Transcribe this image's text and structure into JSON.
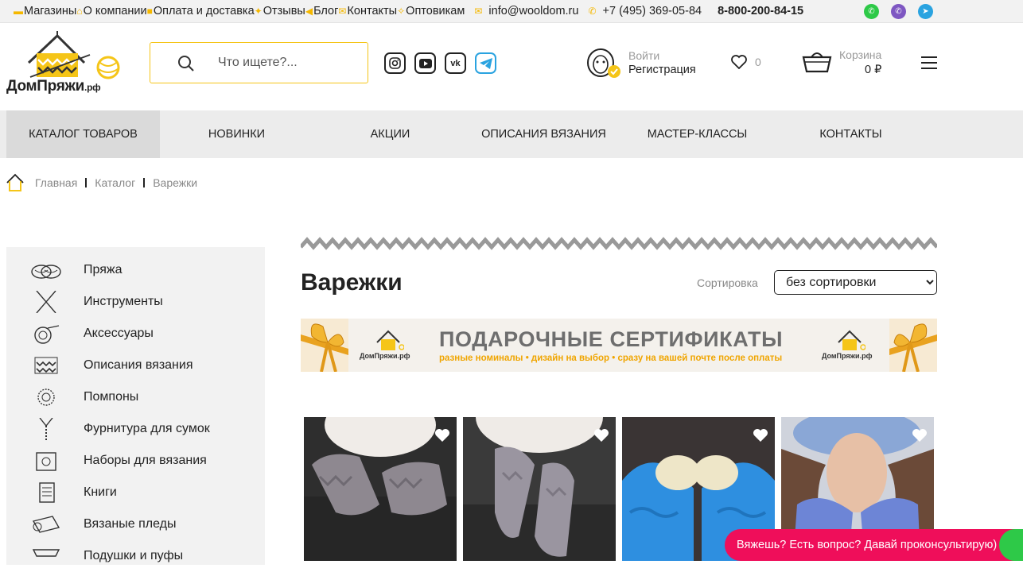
{
  "topbar": {
    "links": [
      "Магазины",
      "О компании",
      "Оплата и доставка",
      "Отзывы",
      "Блог",
      "Контакты",
      "Оптовикам"
    ],
    "email": "info@wooldom.ru",
    "phone": "+7 (495) 369-05-84",
    "free_phone": "8-800-200-84-15",
    "messengers": [
      "whatsapp-icon",
      "viber-icon",
      "telegram-icon"
    ]
  },
  "header": {
    "logo_text": "ДомПряжи",
    "logo_suffix": ".рф",
    "search_placeholder": "Что ищете?...",
    "social": [
      "instagram-icon",
      "youtube-icon",
      "vk-icon",
      "telegram-icon"
    ],
    "login": "Войти",
    "register": "Регистрация",
    "favorites_count": "0",
    "cart_label": "Корзина",
    "cart_total": "0 ₽"
  },
  "nav": [
    "КАТАЛОГ ТОВАРОВ",
    "НОВИНКИ",
    "АКЦИИ",
    "ОПИСАНИЯ ВЯЗАНИЯ",
    "МАСТЕР-КЛАССЫ",
    "КОНТАКТЫ"
  ],
  "breadcrumbs": [
    "Главная",
    "Каталог",
    "Варежки"
  ],
  "sidebar": [
    "Пряжа",
    "Инструменты",
    "Аксессуары",
    "Описания вязания",
    "Помпоны",
    "Фурнитура для сумок",
    "Наборы для вязания",
    "Книги",
    "Вязаные пледы",
    "Подушки и пуфы"
  ],
  "page": {
    "title": "Варежки",
    "sort_label": "Сортировка",
    "sort_value": "без сортировки"
  },
  "banner": {
    "title": "ПОДАРОЧНЫЕ СЕРТИФИКАТЫ",
    "subtitle": "разные номиналы • дизайн на выбор • сразу на вашей почте после оплаты",
    "logo_text": "ДомПряжи.рф"
  },
  "products": [
    {
      "image": "grey knitted fingerless mittens"
    },
    {
      "image": "grey chunky knitted mittens"
    },
    {
      "image": "blue and cream chunky mittens"
    },
    {
      "image": "woman in blue cable-knit mittens"
    }
  ],
  "chat": {
    "text": "Вяжешь? Есть вопрос? Давай проконсультирую)"
  },
  "colors": {
    "accent": "#f5c518",
    "chat": "#ef0e5a",
    "nav_bg": "#ececec"
  }
}
